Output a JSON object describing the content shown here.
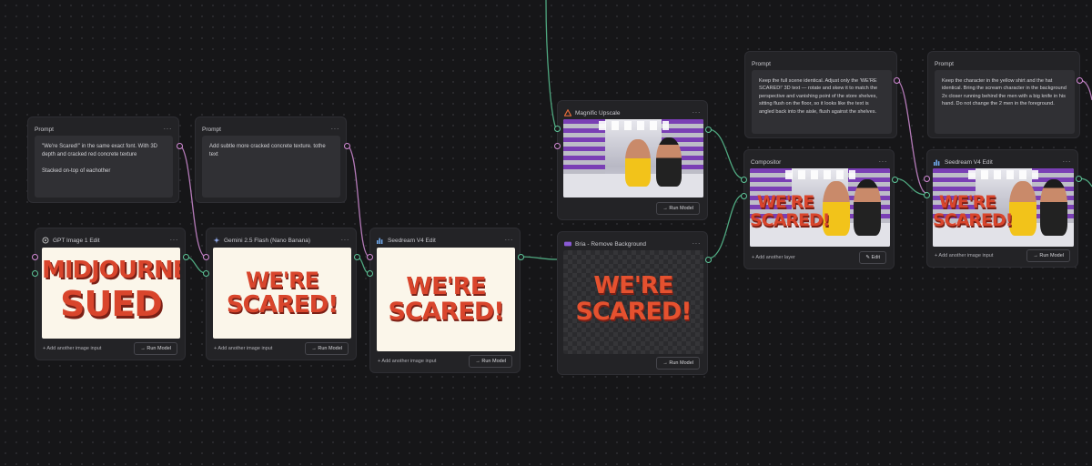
{
  "colors": {
    "background": "#161618",
    "node": "#232326",
    "wire_purple": "#d68cd9",
    "wire_green": "#5ec79a",
    "wordart_red": "#d9452c"
  },
  "prompts": [
    {
      "title": "Prompt",
      "text": "\"We're Scared!\" in the same exact font. With 3D depth and cracked red concrete texture\n\nStacked on-top of eachother"
    },
    {
      "title": "Prompt",
      "text": "Add subtle more cracked concrete texture. tothe text"
    },
    {
      "title": "Prompt",
      "text": "Keep the full scene identical. Adjust only the 'WE'RE SCARED!' 3D text — rotate and skew it to match the perspective and vanishing point of the store shelves, sitting flush on the floor, so it looks like the text is angled back into the aisle, flush against the shelves."
    },
    {
      "title": "Prompt",
      "text": "Keep the character in the yellow shirt and the hat identical. Bring the scream character in the background 2x closer running behind the men with a big knife in his hand. Do not change the 2 men in the foreground."
    }
  ],
  "nodes": {
    "gpt": {
      "title": "GPT Image 1 Edit",
      "icon": "openai-icon",
      "add": "+ Add another image input",
      "run": "→ Run Model",
      "art1": "MIDJOURNEY",
      "art2": "SUED"
    },
    "gemini": {
      "title": "Gemini 2.5 Flash (Nano Banana)",
      "icon": "gemini-sparkle-icon",
      "add": "+ Add another image input",
      "run": "→ Run Model",
      "art1": "WE'RE",
      "art2": "SCARED!"
    },
    "seedream1": {
      "title": "Seedream V4 Edit",
      "icon": "bar-chart-icon",
      "add": "+ Add another image input",
      "run": "→ Run Model",
      "art1": "WE'RE",
      "art2": "SCARED!"
    },
    "upscale": {
      "title": "Magnific Upscale",
      "icon": "triangle-icon",
      "run": "→ Run Model"
    },
    "bria": {
      "title": "Bria - Remove Background",
      "icon": "bria-icon",
      "run": "→ Run Model",
      "art1": "WE'RE",
      "art2": "SCARED!"
    },
    "compositor": {
      "title": "Compositor",
      "add": "+ Add another layer",
      "edit": "✎ Edit",
      "art1": "WE'RE",
      "art2": "SCARED!"
    },
    "seedream2": {
      "title": "Seedream V4 Edit",
      "icon": "bar-chart-icon",
      "add": "+ Add another image input",
      "run": "→ Run Model",
      "art1": "WE'RE",
      "art2": "SCARED!"
    }
  }
}
